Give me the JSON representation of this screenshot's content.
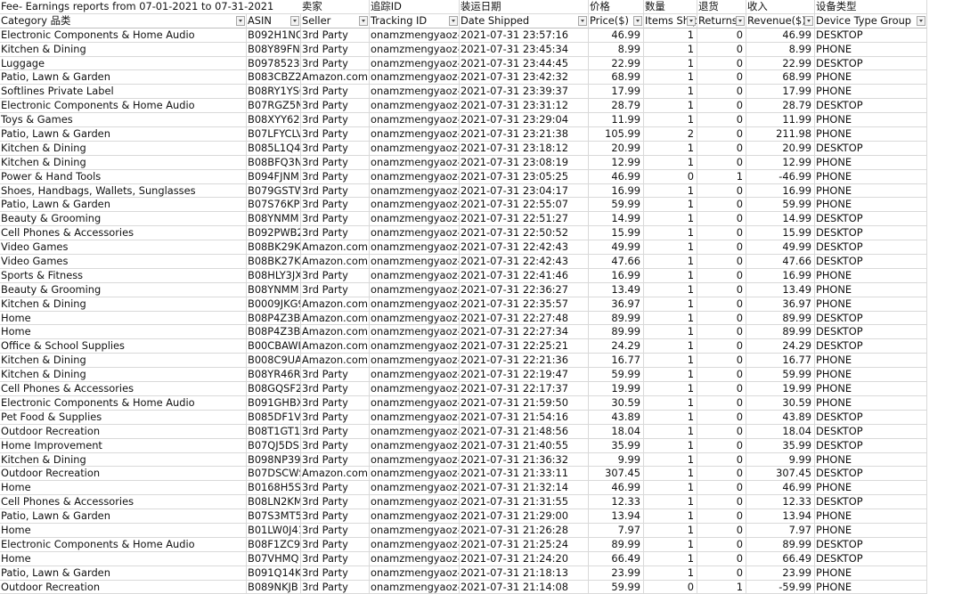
{
  "report_title": "Fee- Earnings reports from 07-01-2021 to 07-31-2021",
  "zh_headers": [
    "",
    "",
    "卖家",
    "追踪ID",
    "装运日期",
    "价格",
    "数量",
    "退货",
    "收入",
    "设备类型"
  ],
  "headers": [
    "Category 品类",
    "ASIN",
    "Seller",
    "Tracking ID",
    "Date Shipped",
    "Price($)",
    "Items Shipped",
    "Returns",
    "Revenue($)",
    "Device Type Group"
  ],
  "rows": [
    [
      "Electronic Components & Home Audio",
      "B092H1NQ",
      "3rd Party",
      "onamzmengyaoz-",
      "2021-07-31 23:57:16",
      "46.99",
      "1",
      "0",
      "46.99",
      "DESKTOP"
    ],
    [
      "Kitchen & Dining",
      "B08Y89FNC",
      "3rd Party",
      "onamzmengyaoz-",
      "2021-07-31 23:45:34",
      "8.99",
      "1",
      "0",
      "8.99",
      "PHONE"
    ],
    [
      "Luggage",
      "B0978523X",
      "3rd Party",
      "onamzmengyaoz-",
      "2021-07-31 23:44:45",
      "22.99",
      "1",
      "0",
      "22.99",
      "DESKTOP"
    ],
    [
      "Patio, Lawn & Garden",
      "B083CBZ2F",
      "Amazon.com",
      "onamzmengyaoz-",
      "2021-07-31 23:42:32",
      "68.99",
      "1",
      "0",
      "68.99",
      "PHONE"
    ],
    [
      "Softlines Private Label",
      "B08RY1YSC",
      "3rd Party",
      "onamzmengyaoz-",
      "2021-07-31 23:39:37",
      "17.99",
      "1",
      "0",
      "17.99",
      "PHONE"
    ],
    [
      "Electronic Components & Home Audio",
      "B07RGZ5N",
      "3rd Party",
      "onamzmengyaoz-",
      "2021-07-31 23:31:12",
      "28.79",
      "1",
      "0",
      "28.79",
      "DESKTOP"
    ],
    [
      "Toys & Games",
      "B08XYY62N",
      "3rd Party",
      "onamzmengyaoz-",
      "2021-07-31 23:29:04",
      "11.99",
      "1",
      "0",
      "11.99",
      "PHONE"
    ],
    [
      "Patio, Lawn & Garden",
      "B07LFYCLV",
      "3rd Party",
      "onamzmengyaoz-",
      "2021-07-31 23:21:38",
      "105.99",
      "2",
      "0",
      "211.98",
      "PHONE"
    ],
    [
      "Kitchen & Dining",
      "B085L1Q4F",
      "3rd Party",
      "onamzmengyaoz-",
      "2021-07-31 23:18:12",
      "20.99",
      "1",
      "0",
      "20.99",
      "DESKTOP"
    ],
    [
      "Kitchen & Dining",
      "B08BFQ3N",
      "3rd Party",
      "onamzmengyaoz-",
      "2021-07-31 23:08:19",
      "12.99",
      "1",
      "0",
      "12.99",
      "PHONE"
    ],
    [
      "Power & Hand Tools",
      "B094FJNM",
      "3rd Party",
      "onamzmengyaoz-",
      "2021-07-31 23:05:25",
      "46.99",
      "0",
      "1",
      "-46.99",
      "PHONE"
    ],
    [
      "Shoes, Handbags, Wallets, Sunglasses",
      "B079GSTW",
      "3rd Party",
      "onamzmengyaoz-",
      "2021-07-31 23:04:17",
      "16.99",
      "1",
      "0",
      "16.99",
      "PHONE"
    ],
    [
      "Patio, Lawn & Garden",
      "B07S76KPZ",
      "3rd Party",
      "onamzmengyaoz-",
      "2021-07-31 22:55:07",
      "59.99",
      "1",
      "0",
      "59.99",
      "PHONE"
    ],
    [
      "Beauty & Grooming",
      "B08YNMM",
      "3rd Party",
      "onamzmengyaoz-",
      "2021-07-31 22:51:27",
      "14.99",
      "1",
      "0",
      "14.99",
      "DESKTOP"
    ],
    [
      "Cell Phones & Accessories",
      "B092PWB2",
      "3rd Party",
      "onamzmengyaoz-",
      "2021-07-31 22:50:52",
      "15.99",
      "1",
      "0",
      "15.99",
      "DESKTOP"
    ],
    [
      "Video Games",
      "B08BK29KR",
      "Amazon.com",
      "onamzmengyaoz-",
      "2021-07-31 22:42:43",
      "49.99",
      "1",
      "0",
      "49.99",
      "DESKTOP"
    ],
    [
      "Video Games",
      "B08BK27KZ",
      "Amazon.com",
      "onamzmengyaoz-",
      "2021-07-31 22:42:43",
      "47.66",
      "1",
      "0",
      "47.66",
      "DESKTOP"
    ],
    [
      "Sports & Fitness",
      "B08HLY3JX",
      "3rd Party",
      "onamzmengyaoz-",
      "2021-07-31 22:41:46",
      "16.99",
      "1",
      "0",
      "16.99",
      "PHONE"
    ],
    [
      "Beauty & Grooming",
      "B08YNMM",
      "3rd Party",
      "onamzmengyaoz-",
      "2021-07-31 22:36:27",
      "13.49",
      "1",
      "0",
      "13.49",
      "PHONE"
    ],
    [
      "Kitchen & Dining",
      "B0009JKG9",
      "Amazon.com",
      "onamzmengyaoz-",
      "2021-07-31 22:35:57",
      "36.97",
      "1",
      "0",
      "36.97",
      "PHONE"
    ],
    [
      "Home",
      "B08P4Z3B5",
      "Amazon.com",
      "onamzmengyaoz-",
      "2021-07-31 22:27:48",
      "89.99",
      "1",
      "0",
      "89.99",
      "DESKTOP"
    ],
    [
      "Home",
      "B08P4Z3B5",
      "Amazon.com",
      "onamzmengyaoz-",
      "2021-07-31 22:27:34",
      "89.99",
      "1",
      "0",
      "89.99",
      "DESKTOP"
    ],
    [
      "Office & School Supplies",
      "B00CBAWII",
      "Amazon.com",
      "onamzmengyaoz-",
      "2021-07-31 22:25:21",
      "24.29",
      "1",
      "0",
      "24.29",
      "DESKTOP"
    ],
    [
      "Kitchen & Dining",
      "B008C9UA",
      "Amazon.com",
      "onamzmengyaoz-",
      "2021-07-31 22:21:36",
      "16.77",
      "1",
      "0",
      "16.77",
      "PHONE"
    ],
    [
      "Kitchen & Dining",
      "B08YR46R",
      "3rd Party",
      "onamzmengyaoz-",
      "2021-07-31 22:19:47",
      "59.99",
      "1",
      "0",
      "59.99",
      "PHONE"
    ],
    [
      "Cell Phones & Accessories",
      "B08GQSF2",
      "3rd Party",
      "onamzmengyaoz-",
      "2021-07-31 22:17:37",
      "19.99",
      "1",
      "0",
      "19.99",
      "PHONE"
    ],
    [
      "Electronic Components & Home Audio",
      "B091GHBX",
      "3rd Party",
      "onamzmengyaoz-",
      "2021-07-31 21:59:50",
      "30.59",
      "1",
      "0",
      "30.59",
      "PHONE"
    ],
    [
      "Pet Food & Supplies",
      "B085DF1VE",
      "3rd Party",
      "onamzmengyaoz-",
      "2021-07-31 21:54:16",
      "43.89",
      "1",
      "0",
      "43.89",
      "DESKTOP"
    ],
    [
      "Outdoor Recreation",
      "B08T1GT1N",
      "3rd Party",
      "onamzmengyaoz-",
      "2021-07-31 21:48:56",
      "18.04",
      "1",
      "0",
      "18.04",
      "DESKTOP"
    ],
    [
      "Home Improvement",
      "B07QJ5DS",
      "3rd Party",
      "onamzmengyaoz-",
      "2021-07-31 21:40:55",
      "35.99",
      "1",
      "0",
      "35.99",
      "DESKTOP"
    ],
    [
      "Kitchen & Dining",
      "B098NP39",
      "3rd Party",
      "onamzmengyaoz-",
      "2021-07-31 21:36:32",
      "9.99",
      "1",
      "0",
      "9.99",
      "PHONE"
    ],
    [
      "Outdoor Recreation",
      "B07DSCWS",
      "Amazon.com",
      "onamzmengyaoz-",
      "2021-07-31 21:33:11",
      "307.45",
      "1",
      "0",
      "307.45",
      "DESKTOP"
    ],
    [
      "Home",
      "B0168H5S",
      "3rd Party",
      "onamzmengyaoz-",
      "2021-07-31 21:32:14",
      "46.99",
      "1",
      "0",
      "46.99",
      "PHONE"
    ],
    [
      "Cell Phones & Accessories",
      "B08LN2KM",
      "3rd Party",
      "onamzmengyaoz-",
      "2021-07-31 21:31:55",
      "12.33",
      "1",
      "0",
      "12.33",
      "DESKTOP"
    ],
    [
      "Patio, Lawn & Garden",
      "B07S3MT5",
      "3rd Party",
      "onamzmengyaoz-",
      "2021-07-31 21:29:00",
      "13.94",
      "1",
      "0",
      "13.94",
      "PHONE"
    ],
    [
      "Home",
      "B01LW0J41",
      "3rd Party",
      "onamzmengyaoz-",
      "2021-07-31 21:26:28",
      "7.97",
      "1",
      "0",
      "7.97",
      "PHONE"
    ],
    [
      "Electronic Components & Home Audio",
      "B08F1ZC9E",
      "3rd Party",
      "onamzmengyaoz-",
      "2021-07-31 21:25:24",
      "89.99",
      "1",
      "0",
      "89.99",
      "DESKTOP"
    ],
    [
      "Home",
      "B07VHMQ",
      "3rd Party",
      "onamzmengyaoz-",
      "2021-07-31 21:24:20",
      "66.49",
      "1",
      "0",
      "66.49",
      "DESKTOP"
    ],
    [
      "Patio, Lawn & Garden",
      "B091Q14K",
      "3rd Party",
      "onamzmengyaoz-",
      "2021-07-31 21:18:13",
      "23.99",
      "1",
      "0",
      "23.99",
      "PHONE"
    ],
    [
      "Outdoor Recreation",
      "B089NKJB",
      "3rd Party",
      "onamzmengyaoz-",
      "2021-07-31 21:14:08",
      "59.99",
      "0",
      "1",
      "-59.99",
      "PHONE"
    ]
  ]
}
